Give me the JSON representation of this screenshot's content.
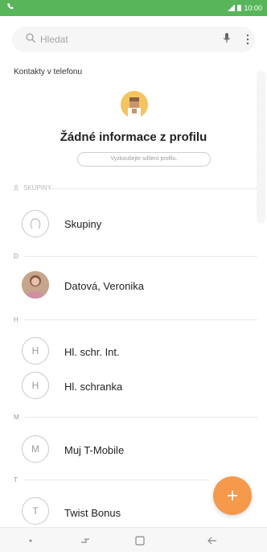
{
  "statusbar": {
    "icon": "phone-icon",
    "time": "10:00"
  },
  "search": {
    "placeholder": "Hledat",
    "mic_icon": "mic-icon",
    "more_icon": "more-vert-icon"
  },
  "section_title": "Kontakty v telefonu",
  "profile": {
    "title": "Žádné informace z profilu",
    "button": "Vyzkoušejte sdílení profilu."
  },
  "groups_header": "SKUPINY",
  "groups": [
    {
      "name": "Skupiny",
      "icon": "person-outline-icon"
    }
  ],
  "sections": [
    {
      "letter": "D",
      "contacts": [
        {
          "name": "Datová, Veronika",
          "avatar": "photo"
        }
      ]
    },
    {
      "letter": "H",
      "contacts": [
        {
          "name": "Hl. schr. Int.",
          "initial": "H"
        },
        {
          "name": "Hl. schranka",
          "initial": "H"
        }
      ]
    },
    {
      "letter": "M",
      "contacts": [
        {
          "name": "Muj T-Mobile",
          "initial": "M"
        }
      ]
    },
    {
      "letter": "T",
      "contacts": [
        {
          "name": "Twist Bonus",
          "initial": "T"
        }
      ]
    }
  ],
  "fab": {
    "label": "+"
  },
  "colors": {
    "statusbar": "#58b55a",
    "fab": "#f5994b",
    "profile_avatar": "#f4c55e"
  }
}
